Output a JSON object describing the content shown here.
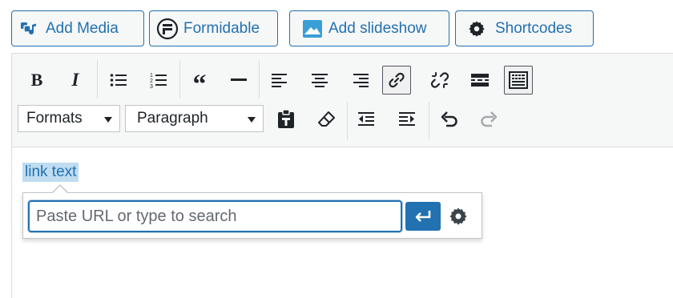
{
  "media_buttons": {
    "add_media": "Add Media",
    "formidable": "Formidable",
    "add_slideshow": "Add slideshow",
    "shortcodes": "Shortcodes"
  },
  "toolbar": {
    "bold_glyph": "B",
    "italic_glyph": "I",
    "quote_glyph": "“",
    "formats_select": "Formats",
    "paragraph_select": "Paragraph"
  },
  "content": {
    "link_text": "link text"
  },
  "link_popup": {
    "url_placeholder": "Paste URL or type to search",
    "url_value": ""
  },
  "colors": {
    "accent": "#2271b1",
    "link_highlight": "#bfdcf0",
    "toolbar_bg": "#f6f7f7",
    "icon": "#1d2327",
    "disabled_icon": "#a7aaad"
  },
  "icons": [
    "add-media-icon",
    "formidable-logo-icon",
    "slideshow-icon",
    "gear-icon",
    "bulleted-list-icon",
    "numbered-list-icon",
    "blockquote-icon",
    "horizontal-line-icon",
    "align-left-icon",
    "align-center-icon",
    "align-right-icon",
    "insert-link-icon",
    "remove-link-icon",
    "read-more-icon",
    "toolbar-toggle-icon",
    "paste-as-text-icon",
    "clear-formatting-icon",
    "outdent-icon",
    "indent-icon",
    "undo-icon",
    "redo-icon",
    "enter-arrow-icon",
    "link-options-gear-icon"
  ]
}
